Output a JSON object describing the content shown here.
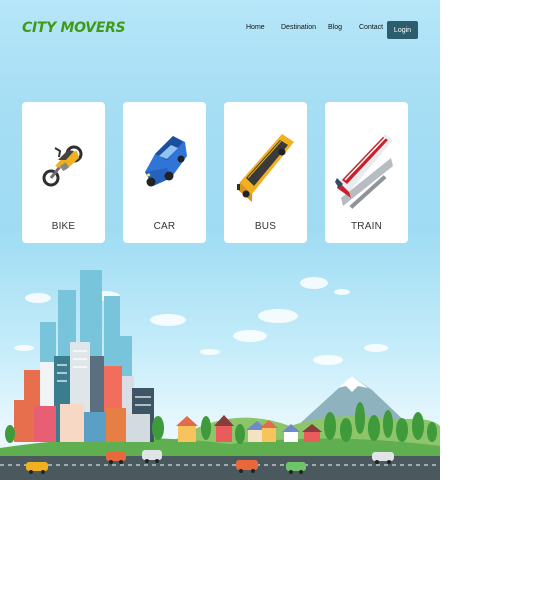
{
  "header": {
    "brand": "CITY MOVERS",
    "nav": [
      "Home",
      "Destination",
      "Blog",
      "Contact"
    ],
    "login_label": "Login"
  },
  "cards": [
    {
      "label": "BIKE",
      "icon": "motorcycle-icon"
    },
    {
      "label": "CAR",
      "icon": "car-icon"
    },
    {
      "label": "BUS",
      "icon": "bus-icon"
    },
    {
      "label": "TRAIN",
      "icon": "train-icon"
    }
  ],
  "colors": {
    "brand": "#3f9b16",
    "login_button": "#2c5d6c",
    "sky": "#a4ddf4",
    "road": "#49595e"
  }
}
